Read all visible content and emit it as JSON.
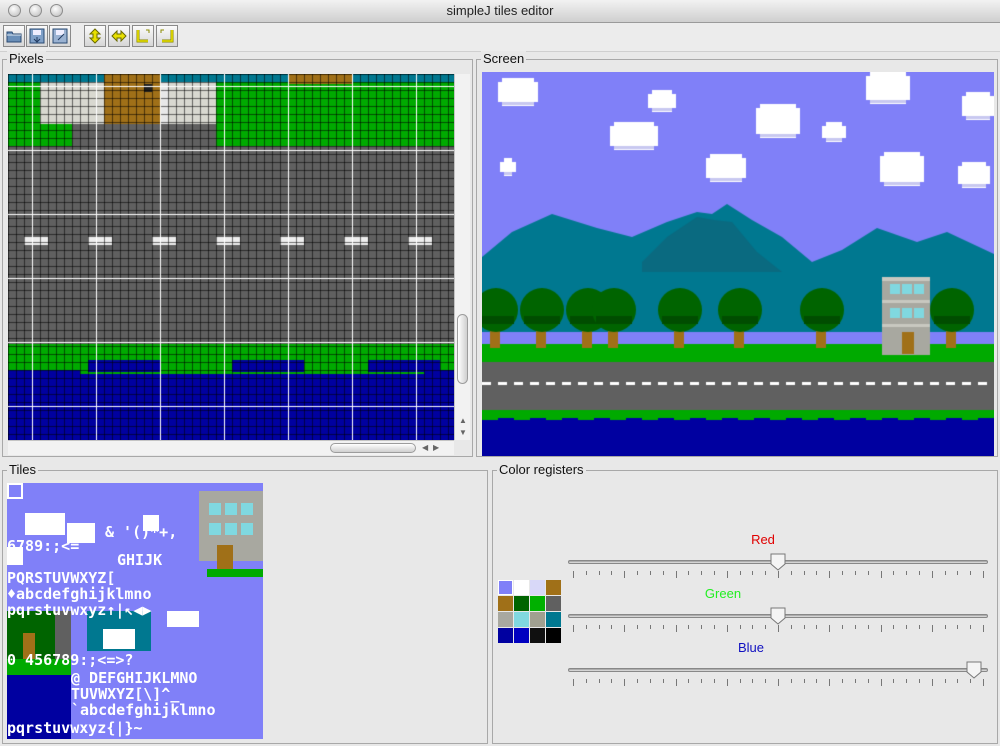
{
  "window": {
    "title": "simpleJ tiles editor"
  },
  "toolbar": {
    "buttons": [
      {
        "name": "open-icon"
      },
      {
        "name": "save-icon"
      },
      {
        "name": "save-as-icon"
      },
      {
        "name": "flip-vertical-icon"
      },
      {
        "name": "flip-horizontal-icon"
      },
      {
        "name": "rotate-left-icon"
      },
      {
        "name": "rotate-right-icon"
      }
    ]
  },
  "pixels_panel": {
    "label": "Pixels"
  },
  "screen_panel": {
    "label": "Screen"
  },
  "tiles_panel": {
    "label": "Tiles",
    "glyph_rows": [
      "& '()*+,",
      "6789:;<=",
      "GHIJK",
      "PQRSTUVWXYZ[",
      "♦abcdefghijklmno",
      "pqrstuvwxyz↑|↖◀▶",
      "0 456789:;<=>?",
      "@ DEFGHIJKLMNO",
      "TUVWXYZ[\\]^_",
      "`abcdefghijklmno",
      "pqrstuvwxyz{|}~"
    ]
  },
  "color_panel": {
    "label": "Color registers",
    "red_label": "Red",
    "green_label": "Green",
    "blue_label": "Blue",
    "red_value": 0.5,
    "green_value": 0.5,
    "blue_value": 1.0,
    "label_colors": {
      "red": "#e00000",
      "green": "#22ee22",
      "blue": "#1010c0"
    },
    "selected_register": 0,
    "registers": [
      "#8080f8",
      "#ffffff",
      "#d8d8f8",
      "#a07018",
      "#a07018",
      "#006400",
      "#00b000",
      "#606060",
      "#a8a8a0",
      "#80d8e0",
      "#a0a090",
      "#007890",
      "#0000a0",
      "#0000c0",
      "#101010",
      "#000000"
    ]
  }
}
